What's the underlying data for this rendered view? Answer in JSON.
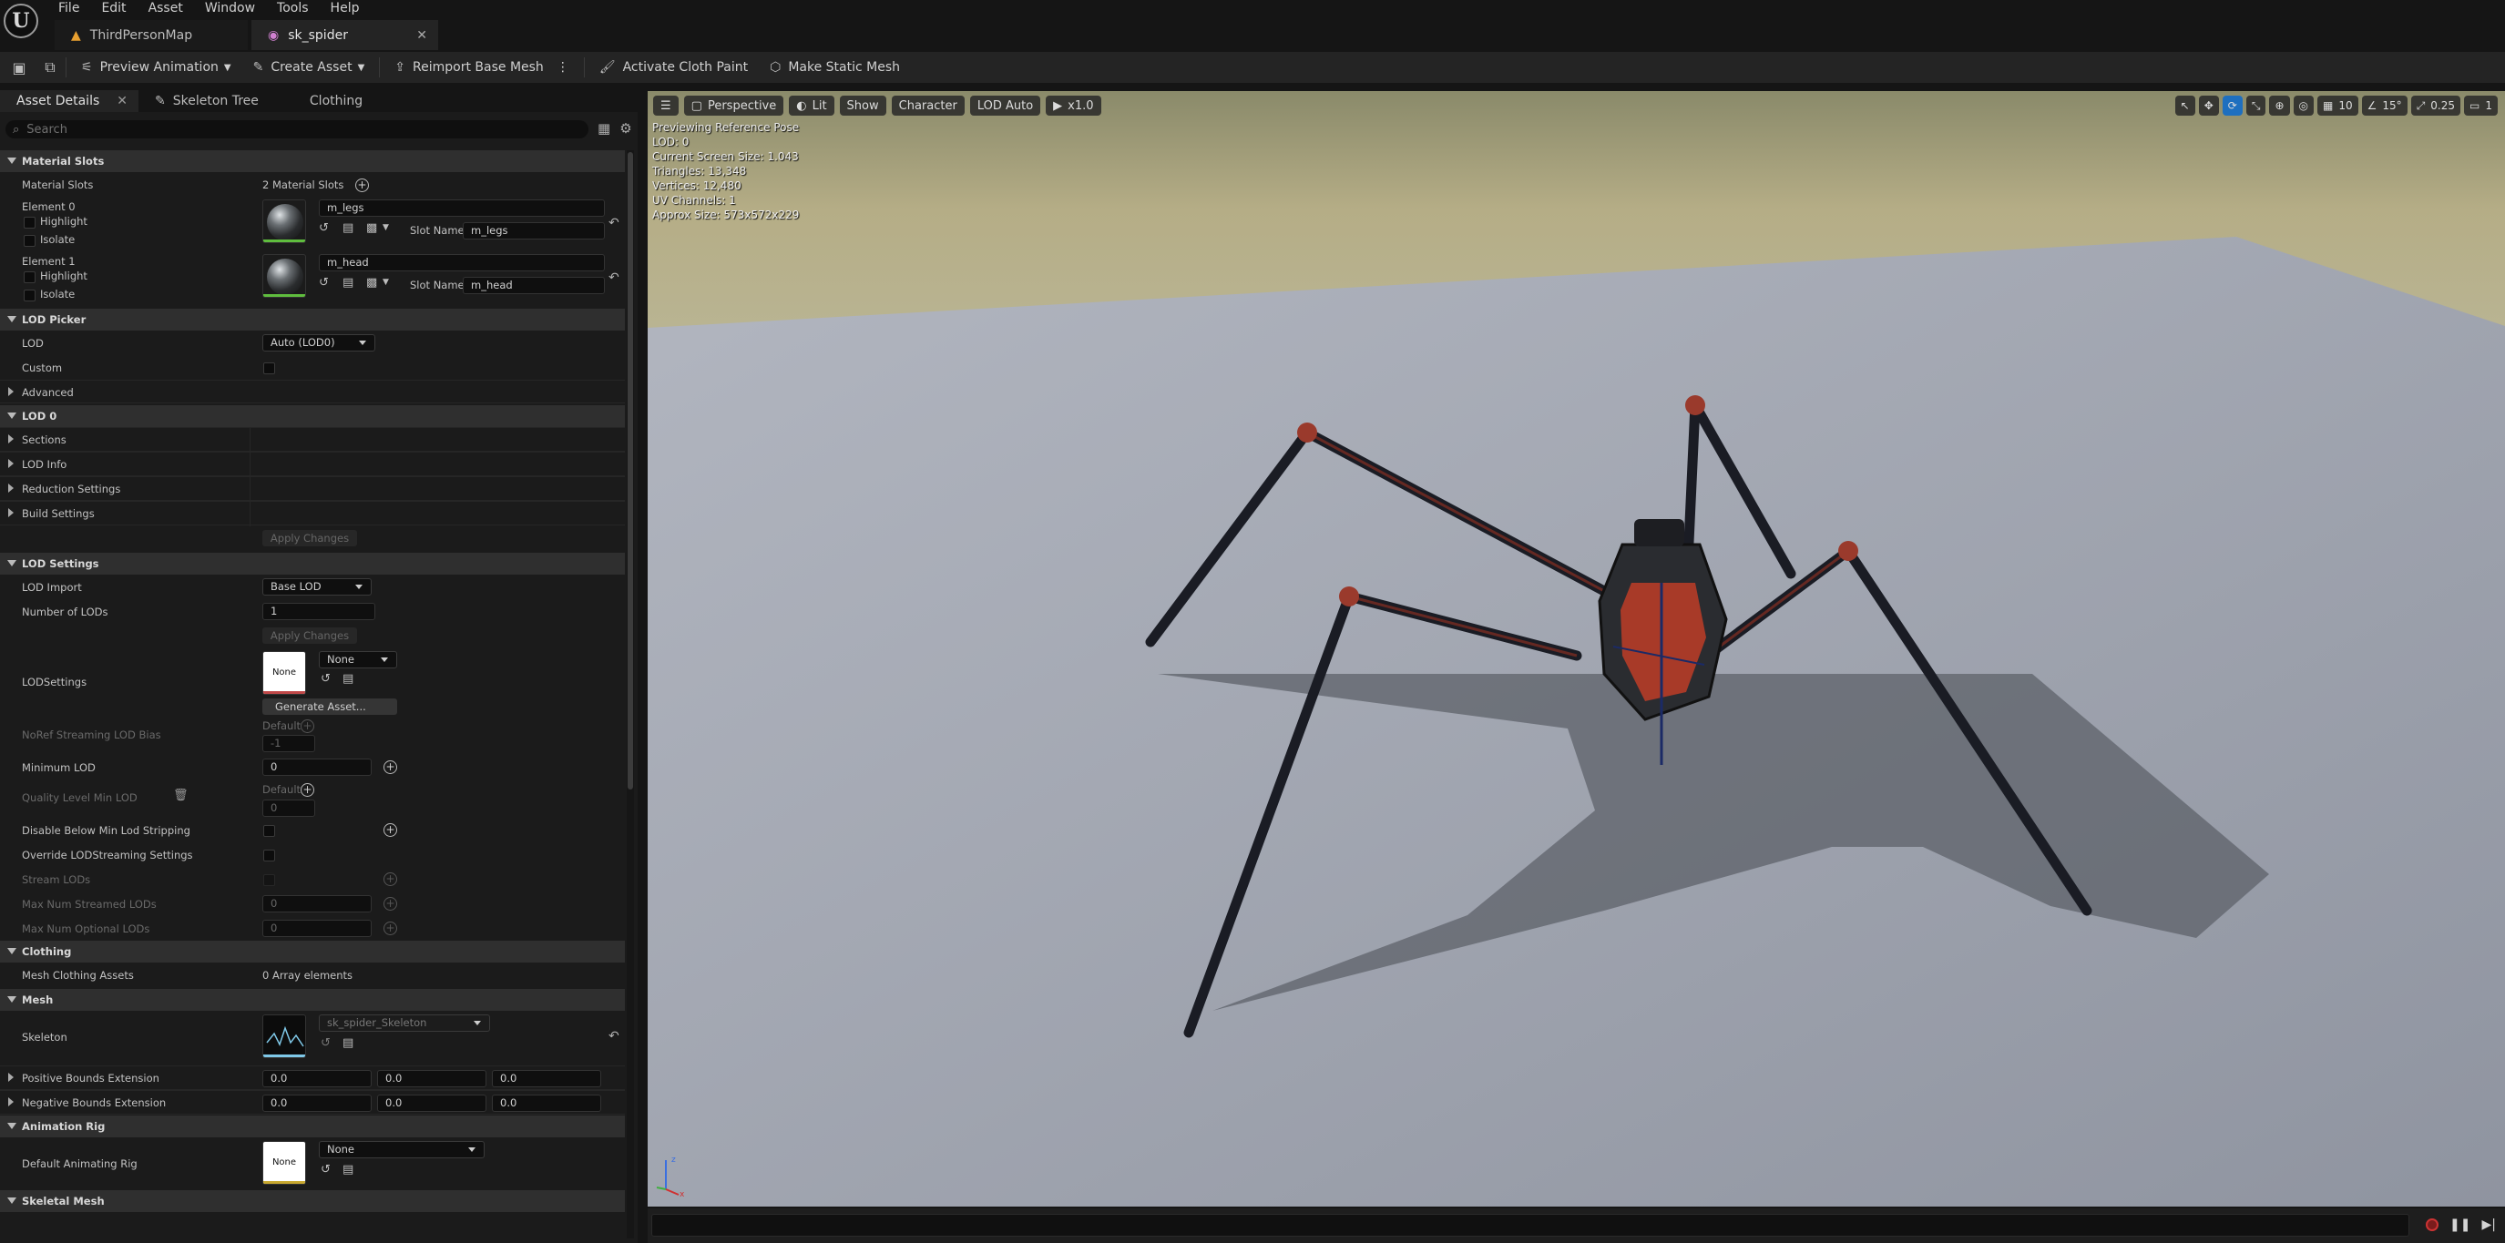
{
  "menu": [
    "File",
    "Edit",
    "Asset",
    "Window",
    "Tools",
    "Help"
  ],
  "doc_tabs": [
    {
      "label": "ThirdPersonMap"
    },
    {
      "label": "sk_spider"
    }
  ],
  "toolbar": {
    "preview_animation": "Preview Animation",
    "create_asset": "Create Asset",
    "reimport": "Reimport Base Mesh",
    "cloth_paint": "Activate Cloth Paint",
    "static_mesh": "Make Static Mesh"
  },
  "panel_tabs": {
    "asset_details": "Asset Details",
    "skeleton_tree": "Skeleton Tree",
    "clothing": "Clothing"
  },
  "search": {
    "placeholder": "Search"
  },
  "material_slots": {
    "header": "Material Slots",
    "label": "Material Slots",
    "count": "2 Material Slots",
    "elements": [
      {
        "label": "Element 0",
        "highlight": "Highlight",
        "isolate": "Isolate",
        "material": "m_legs",
        "slot_label": "Slot Name",
        "slot_name": "m_legs"
      },
      {
        "label": "Element 1",
        "highlight": "Highlight",
        "isolate": "Isolate",
        "material": "m_head",
        "slot_label": "Slot Name",
        "slot_name": "m_head"
      }
    ]
  },
  "lod_picker": {
    "header": "LOD Picker",
    "lod_label": "LOD",
    "lod_value": "Auto (LOD0)",
    "custom_label": "Custom",
    "advanced": "Advanced"
  },
  "lod0": {
    "header": "LOD 0",
    "sections": "Sections",
    "lod_info": "LOD Info",
    "reduction": "Reduction Settings",
    "build": "Build Settings",
    "apply": "Apply Changes"
  },
  "lod_settings": {
    "header": "LOD Settings",
    "import_label": "LOD Import",
    "import_value": "Base LOD",
    "num_label": "Number of LODs",
    "num_value": "1",
    "apply": "Apply Changes",
    "settings_label": "LODSettings",
    "settings_value": "None",
    "thumb_none": "None",
    "generate": "Generate Asset...",
    "noref_label": "NoRef Streaming LOD Bias",
    "noref_default": "Default",
    "noref_value": "-1",
    "min_lod_label": "Minimum LOD",
    "min_lod_value": "0",
    "quality_label": "Quality Level Min LOD",
    "quality_default": "Default",
    "quality_value": "0",
    "disable_below": "Disable Below Min Lod Stripping",
    "override_streaming": "Override LODStreaming Settings",
    "stream_lods": "Stream LODs",
    "max_streamed": "Max Num Streamed LODs",
    "max_streamed_value": "0",
    "max_optional": "Max Num Optional LODs",
    "max_optional_value": "0"
  },
  "clothing": {
    "header": "Clothing",
    "assets_label": "Mesh Clothing Assets",
    "assets_value": "0 Array elements"
  },
  "mesh": {
    "header": "Mesh",
    "skeleton_label": "Skeleton",
    "skeleton_value": "sk_spider_Skeleton",
    "pos_bounds": "Positive Bounds Extension",
    "pos_values": [
      "0.0",
      "0.0",
      "0.0"
    ],
    "neg_bounds": "Negative Bounds Extension",
    "neg_values": [
      "0.0",
      "0.0",
      "0.0"
    ]
  },
  "anim_rig": {
    "header": "Animation Rig",
    "label": "Default Animating Rig",
    "value": "None",
    "thumb_none": "None"
  },
  "skeletal_mesh": {
    "header": "Skeletal Mesh"
  },
  "viewport": {
    "perspective": "Perspective",
    "lit": "Lit",
    "show": "Show",
    "character": "Character",
    "lod": "LOD Auto",
    "speed": "x1.0",
    "grid": "10",
    "angle": "15°",
    "scale": "0.25",
    "camera": "1",
    "stats": [
      "Previewing Reference Pose",
      "LOD: 0",
      "Current Screen Size: 1.043",
      "Triangles: 13,348",
      "Vertices: 12,480",
      "UV Channels: 1",
      "Approx Size: 573x572x229"
    ]
  }
}
